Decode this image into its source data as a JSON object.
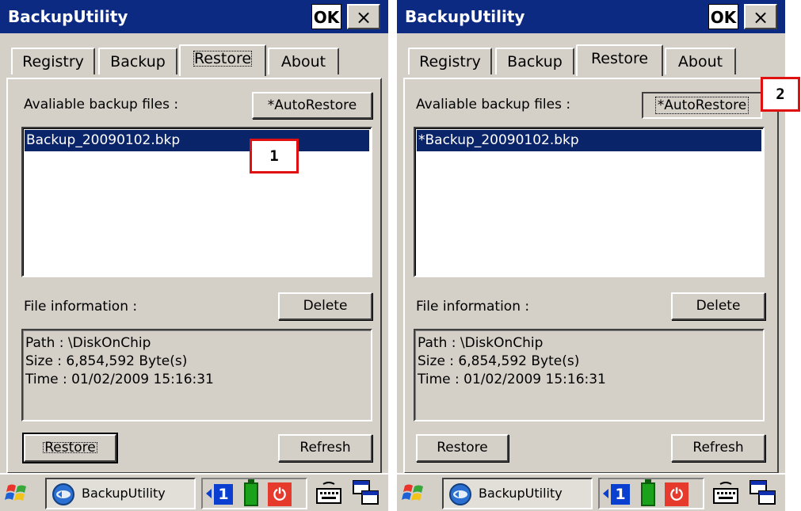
{
  "app_title": "BackupUtility",
  "title_buttons": {
    "ok": "OK",
    "close": "×"
  },
  "tabs": [
    "Registry",
    "Backup",
    "Restore",
    "About"
  ],
  "restore_panel": {
    "available_label": "Avaliable backup files :",
    "autorestore_label": "*AutoRestore",
    "file_info_label": "File information :",
    "delete_label": "Delete",
    "restore_label": "Restore",
    "refresh_label": "Refresh"
  },
  "screens": [
    {
      "list_item": "Backup_20090102.bkp",
      "info": {
        "path": "Path : \\DiskOnChip",
        "size": "Size : 6,854,592 Byte(s)",
        "time": "Time : 01/02/2009 15:16:31"
      }
    },
    {
      "list_item": "*Backup_20090102.bkp",
      "info": {
        "path": "Path : \\DiskOnChip",
        "size": "Size : 6,854,592 Byte(s)",
        "time": "Time : 01/02/2009 15:16:31"
      }
    }
  ],
  "taskbar": {
    "task_label": "BackupUtility",
    "tray_number": "1",
    "icons": [
      "windows-start-icon",
      "backup-app-icon",
      "tray-left-arrow-icon",
      "tray-number-icon",
      "battery-icon",
      "power-icon",
      "keyboard-icon",
      "window-switch-icon"
    ]
  },
  "callouts": [
    "1",
    "2"
  ],
  "colors": {
    "titlebar": "#0c2a82",
    "selection": "#0a246a",
    "face": "#d4d0c8",
    "callout_border": "#e01010"
  }
}
